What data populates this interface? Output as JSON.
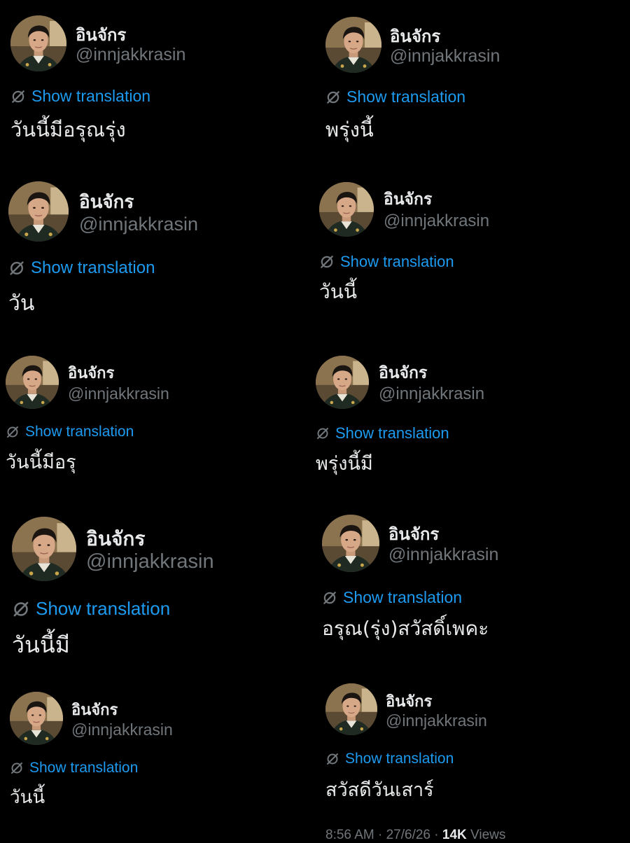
{
  "tweets": [
    {
      "name": "อินจักร",
      "handle": "@innjakkrasin",
      "translate": "Show translation",
      "text": "วันนี้มีอรุณรุ่ง"
    },
    {
      "name": "อินจักร",
      "handle": "@innjakkrasin",
      "translate": "Show translation",
      "text": "พรุ่งนี้"
    },
    {
      "name": "อินจักร",
      "handle": "@innjakkrasin",
      "translate": "Show translation",
      "text": "วัน"
    },
    {
      "name": "อินจักร",
      "handle": "@innjakkrasin",
      "translate": "Show translation",
      "text": "วันนี้"
    },
    {
      "name": "อินจักร",
      "handle": "@innjakkrasin",
      "translate": "Show translation",
      "text": "วันนี้มีอรุ"
    },
    {
      "name": "อินจักร",
      "handle": "@innjakkrasin",
      "translate": "Show translation",
      "text": "พรุ่งนี้มี"
    },
    {
      "name": "อินจักร",
      "handle": "@innjakkrasin",
      "translate": "Show translation",
      "text": "วันนี้มี"
    },
    {
      "name": "อินจักร",
      "handle": "@innjakkrasin",
      "translate": "Show translation",
      "text": "อรุณ(รุ่ง)สวัสดิ์เพคะ"
    },
    {
      "name": "อินจักร",
      "handle": "@innjakkrasin",
      "translate": "Show translation",
      "text": "วันนี้"
    },
    {
      "name": "อินจักร",
      "handle": "@innjakkrasin",
      "translate": "Show translation",
      "text": "สวัสดีวันเสาร์"
    }
  ],
  "footer": {
    "time": "8:56 AM",
    "date": "27/6/26",
    "views_count": "14K",
    "views_label": "Views",
    "separator": "·"
  },
  "icons": {
    "translate": "translate-slash-icon"
  },
  "colors": {
    "link": "#1d9bf0",
    "secondary": "#71767b",
    "primary": "#e7e9ea",
    "background": "#000000"
  }
}
